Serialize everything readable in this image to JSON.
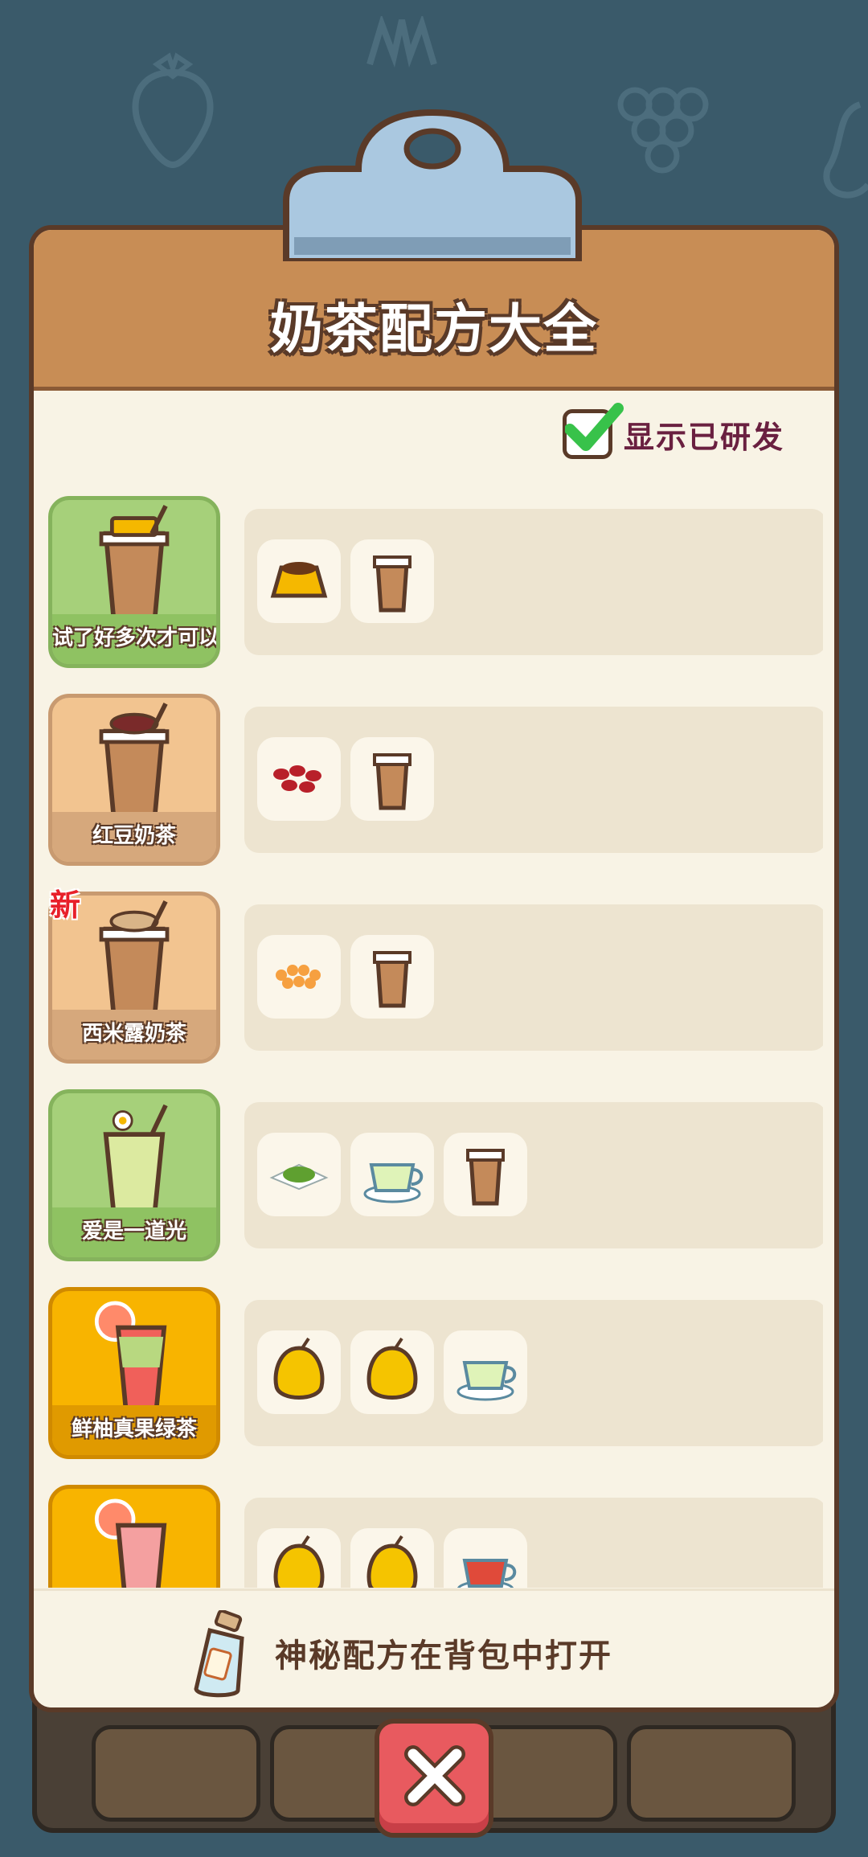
{
  "board": {
    "title": "奶茶配方大全"
  },
  "toggle": {
    "label": "显示已研发",
    "checked": true
  },
  "recipes": [
    {
      "name": "试了好多次才可以",
      "theme": "green",
      "is_new": false,
      "drink_icon": "pudding-milk-tea-icon",
      "ingredients": [
        "pudding-icon",
        "milk-tea-cup-icon"
      ]
    },
    {
      "name": "红豆奶茶",
      "theme": "tan",
      "is_new": false,
      "drink_icon": "red-bean-milk-tea-icon",
      "ingredients": [
        "red-bean-icon",
        "milk-tea-cup-icon"
      ]
    },
    {
      "name": "西米露奶茶",
      "theme": "tan",
      "is_new": true,
      "drink_icon": "sago-milk-tea-icon",
      "ingredients": [
        "sago-icon",
        "milk-tea-cup-icon"
      ]
    },
    {
      "name": "爱是一道光",
      "theme": "green",
      "is_new": false,
      "drink_icon": "matcha-drink-icon",
      "ingredients": [
        "matcha-powder-icon",
        "green-tea-cup-icon",
        "milk-tea-cup-icon"
      ]
    },
    {
      "name": "鲜柚真果绿茶",
      "theme": "orange",
      "is_new": false,
      "drink_icon": "grapefruit-green-tea-icon",
      "ingredients": [
        "pomelo-icon",
        "pomelo-icon",
        "green-tea-cup-icon"
      ]
    },
    {
      "name": "",
      "theme": "orange",
      "is_new": false,
      "drink_icon": "grapefruit-red-tea-icon",
      "ingredients": [
        "pomelo-icon",
        "pomelo-icon",
        "red-tea-cup-icon"
      ]
    }
  ],
  "new_badge": "新",
  "hint": {
    "text": "神秘配方在背包中打开",
    "icon": "bottle-icon"
  },
  "close": {
    "icon": "close-icon"
  },
  "colors": {
    "background": "#3a5a6a",
    "header": "#c88d55",
    "green_card": "#a6d07a",
    "tan_card": "#f2c490",
    "orange_card": "#f8b400",
    "close_button": "#e85a5f"
  }
}
